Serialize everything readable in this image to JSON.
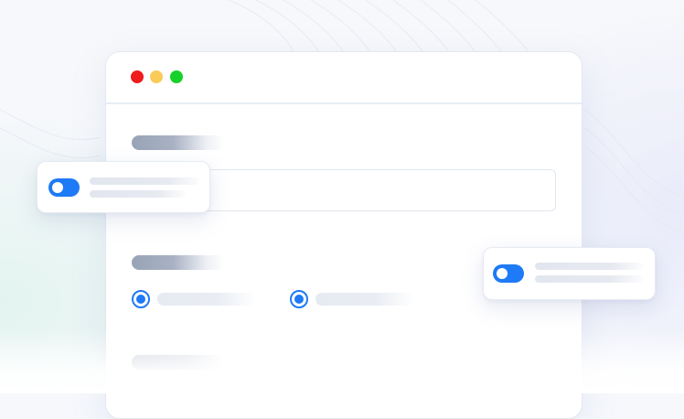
{
  "window": {
    "controls": [
      {
        "name": "close",
        "color": "#ee1c1c"
      },
      {
        "name": "minimize",
        "color": "#f9cb58"
      },
      {
        "name": "maximize",
        "color": "#16d12a"
      }
    ]
  },
  "form": {
    "text_field": {
      "value": "",
      "placeholder": ""
    },
    "radio_options": [
      {
        "label": "",
        "selected": true
      },
      {
        "label": "",
        "selected": true
      }
    ]
  },
  "floating_cards": [
    {
      "toggle_on": true,
      "accent": "#1e7af6"
    },
    {
      "toggle_on": true,
      "accent": "#1e7af6"
    }
  ],
  "colors": {
    "accent": "#1e7af6",
    "placeholder_label": "#98a3b7",
    "placeholder_line": "#e2e6ee"
  }
}
